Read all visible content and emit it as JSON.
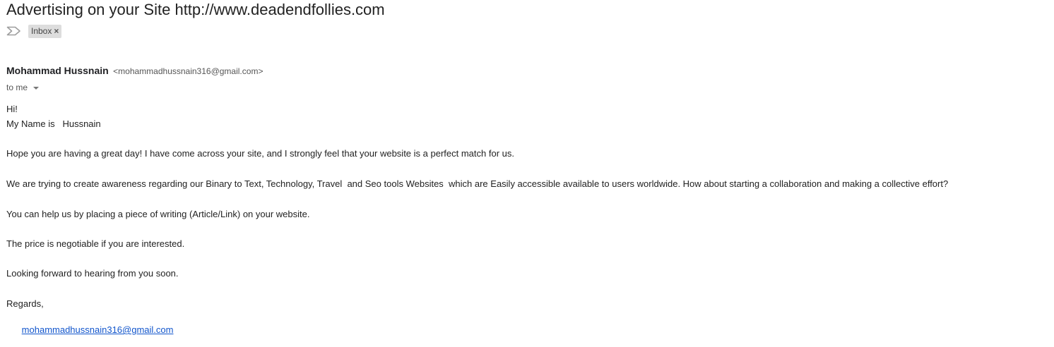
{
  "email": {
    "subject": "Advertising on your Site http://www.deadendfollies.com",
    "label": "Inbox",
    "label_remove": "×",
    "sender": {
      "name": "Mohammad Hussnain",
      "email": "<mohammadhussnain316@gmail.com>"
    },
    "recipient": "to me",
    "body": {
      "greeting": "Hi!",
      "name_line": "My Name is   Hussnain",
      "p1": "Hope you are having a great day! I have come across your site, and I strongly feel that your website is a perfect match for us.",
      "p2": "We are trying to create awareness regarding our Binary to Text, Technology, Travel  and Seo tools Websites  which are Easily accessible available to users worldwide. How about starting a collaboration and making a collective effort?",
      "p3": "You can help us by placing a piece of writing (Article/Link) on your website.",
      "p4": "The price is negotiable if you are interested.",
      "p5": "Looking forward to hearing from you soon.",
      "closing": "Regards,",
      "signature_link": "mohammadhussnain316@gmail.com"
    }
  },
  "icons": {
    "important": "important-marker-icon",
    "recipient_caret": "caret-down-icon"
  },
  "colors": {
    "link": "#1155cc",
    "label_chip_bg": "#dddddd",
    "text": "#222222",
    "muted": "#555555"
  }
}
